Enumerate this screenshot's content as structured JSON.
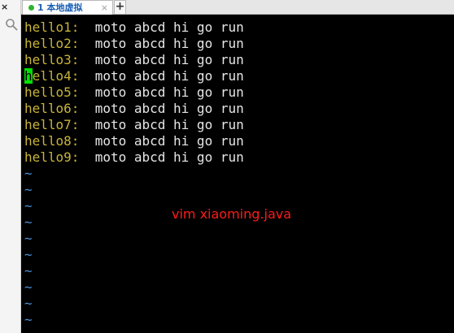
{
  "sidebar": {
    "close_glyph": "×",
    "search_icon": "search-icon"
  },
  "tabbar": {
    "tab": {
      "label": "1 本地虚拟",
      "close_glyph": "×",
      "status_color": "#2fb42f"
    },
    "add_glyph": "+"
  },
  "terminal": {
    "cursor_color": "#00e000",
    "lines": [
      {
        "prefix": "hello1:",
        "content": "moto abcd hi go run"
      },
      {
        "prefix": "hello2:",
        "content": "moto abcd hi go run"
      },
      {
        "prefix": "hello3:",
        "content": "moto abcd hi go run"
      },
      {
        "prefix": "hello4:",
        "content": "moto abcd hi go run",
        "cursor": true
      },
      {
        "prefix": "hello5:",
        "content": "moto abcd hi go run"
      },
      {
        "prefix": "hello6:",
        "content": "moto abcd hi go run"
      },
      {
        "prefix": "hello7:",
        "content": "moto abcd hi go run"
      },
      {
        "prefix": "hello8:",
        "content": "moto abcd hi go run"
      },
      {
        "prefix": "hello9:",
        "content": "moto abcd hi go run"
      }
    ],
    "tilde": "~",
    "tilde_count": 10
  },
  "annotation": {
    "text": "vim xiaoming.java",
    "color": "#ff1a1a"
  }
}
